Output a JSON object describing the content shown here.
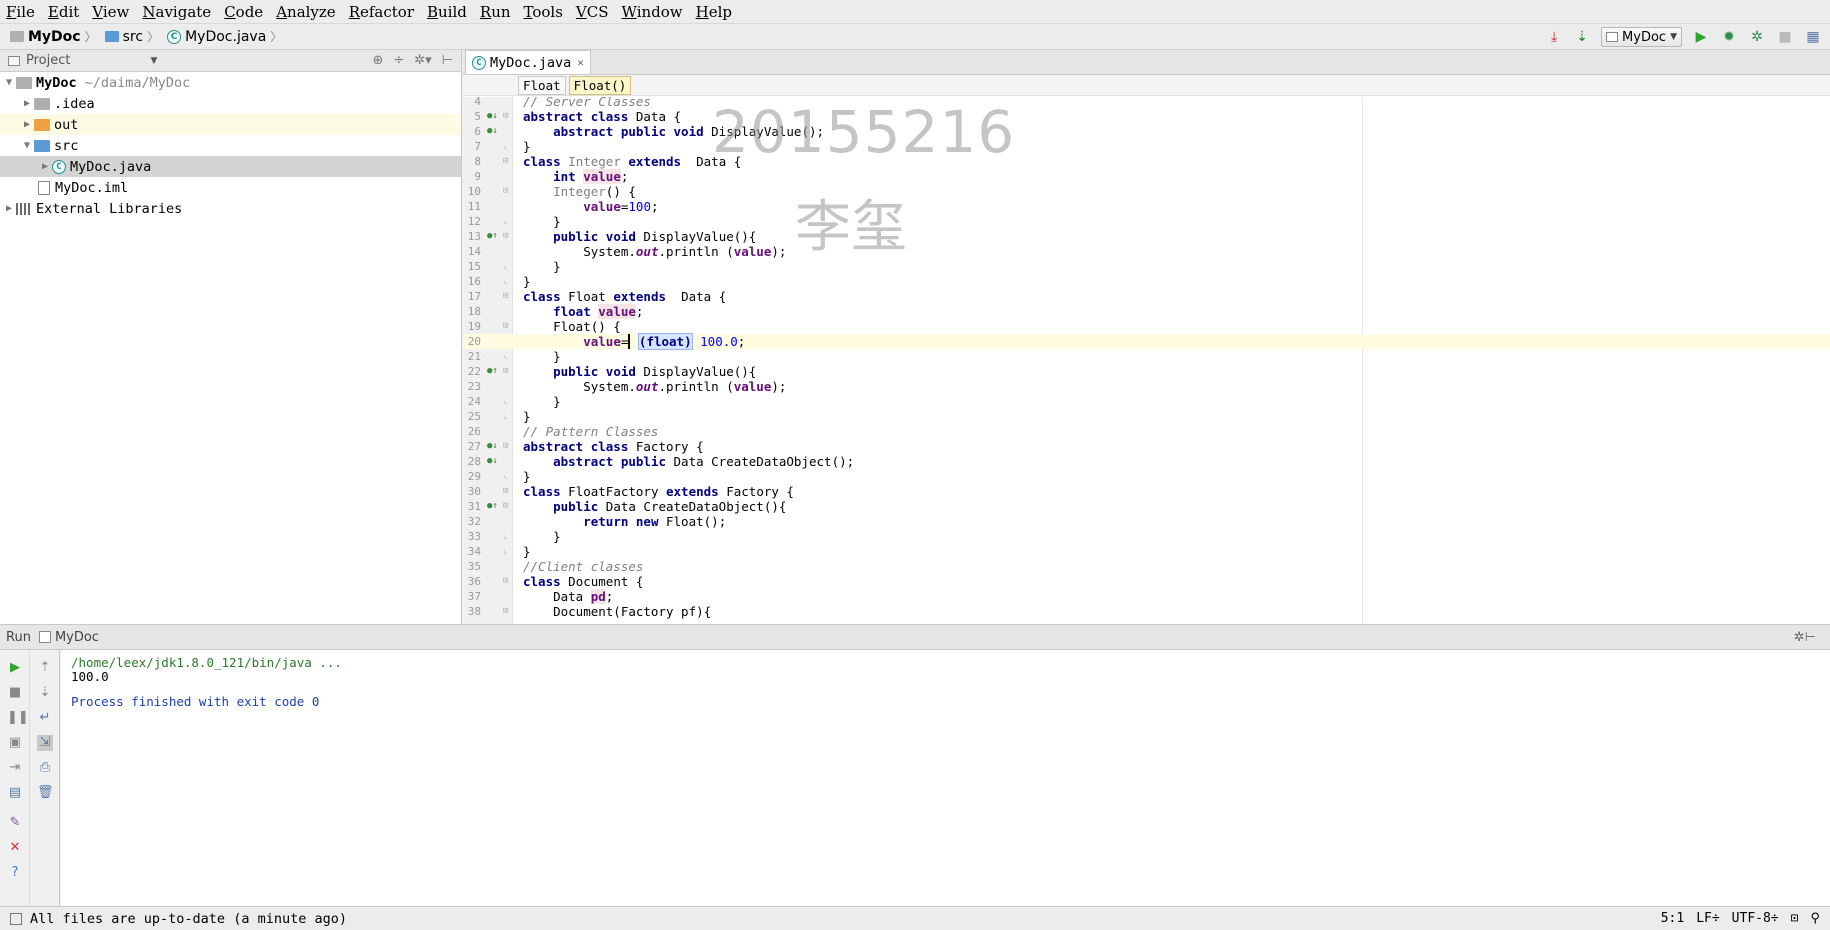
{
  "menu": [
    "File",
    "Edit",
    "View",
    "Navigate",
    "Code",
    "Analyze",
    "Refactor",
    "Build",
    "Run",
    "Tools",
    "VCS",
    "Window",
    "Help"
  ],
  "nav": {
    "project": "MyDoc",
    "folder": "src",
    "file": "MyDoc.java",
    "run_config": "MyDoc"
  },
  "project_panel": {
    "title": "Project",
    "root_name": "MyDoc",
    "root_path": "~/daima/MyDoc",
    "items": [
      ".idea",
      "out",
      "src",
      "MyDoc.java",
      "MyDoc.iml",
      "External Libraries"
    ]
  },
  "editor": {
    "tab": "MyDoc.java",
    "breadcrumbs": [
      "Float",
      "Float()"
    ],
    "watermark_id": "20155216",
    "watermark_name": "李玺",
    "line_numbers": [
      "4",
      "5",
      "6",
      "7",
      "8",
      "9",
      "10",
      "11",
      "12",
      "13",
      "14",
      "15",
      "16",
      "17",
      "18",
      "19",
      "20",
      "21",
      "22",
      "23",
      "24",
      "25",
      "26",
      "27",
      "28",
      "29",
      "30",
      "31",
      "32",
      "33",
      "34",
      "35",
      "36",
      "37",
      "38"
    ]
  },
  "run_panel": {
    "title": "Run",
    "tab": "MyDoc",
    "console": [
      "/home/leex/jdk1.8.0_121/bin/java ...",
      "100.0",
      "",
      "Process finished with exit code 0"
    ]
  },
  "status": {
    "message": "All files are up-to-date (a minute ago)",
    "position": "5:1",
    "line_sep": "LF÷",
    "encoding": "UTF-8÷"
  },
  "colors": {
    "keyword": "#000080",
    "field": "#660e7a",
    "number": "#0000ff",
    "comment": "#808080",
    "console_path": "#2a7a2a",
    "console_msg": "#1a3fb0"
  }
}
